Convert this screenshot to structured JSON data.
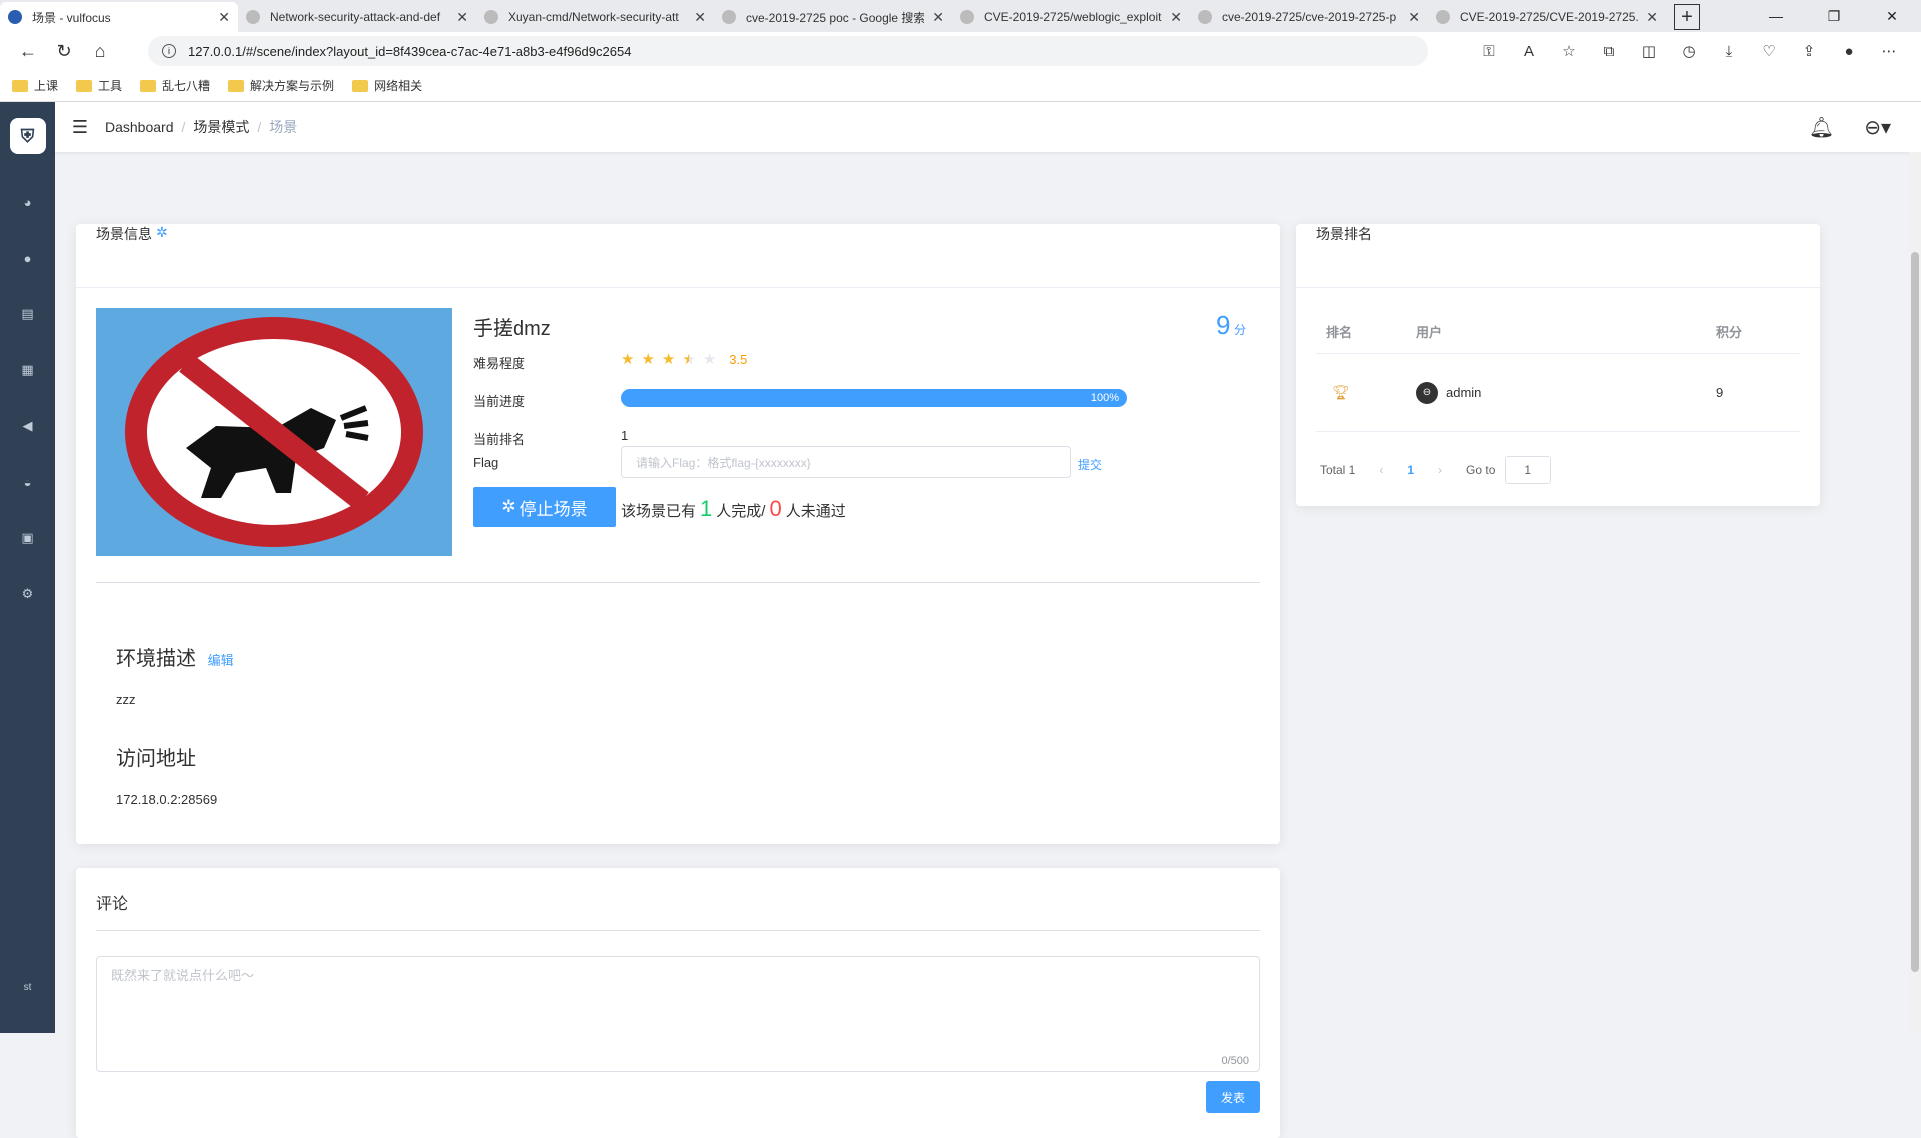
{
  "browser": {
    "tabs": [
      {
        "title": "场景 - vulfocus",
        "active": true
      },
      {
        "title": "Network-security-attack-and-def",
        "active": false
      },
      {
        "title": "Xuyan-cmd/Network-security-att",
        "active": false
      },
      {
        "title": "cve-2019-2725 poc - Google 搜索",
        "active": false
      },
      {
        "title": "CVE-2019-2725/weblogic_exploit",
        "active": false
      },
      {
        "title": "cve-2019-2725/cve-2019-2725-p",
        "active": false
      },
      {
        "title": "CVE-2019-2725/CVE-2019-2725.",
        "active": false
      }
    ],
    "url": "127.0.0.1/#/scene/index?layout_id=8f439cea-c7ac-4e71-a8b3-e4f96d9c2654",
    "bookmarks": [
      "上课",
      "工具",
      "乱七八糟",
      "解决方案与示例",
      "网络相关"
    ]
  },
  "navbar": {
    "breadcrumb": [
      "Dashboard",
      "场景模式",
      "场景"
    ]
  },
  "scene": {
    "header": "场景信息",
    "title": "手搓dmz",
    "score": "9",
    "score_unit": "分",
    "difficulty_label": "难易程度",
    "difficulty_value": "3.5",
    "progress_label": "当前进度",
    "progress_value": 1.0,
    "progress_text": "100%",
    "rank_label": "当前排名",
    "rank_value": "1",
    "flag_label": "Flag",
    "flag_placeholder": "请输入Flag：格式flag-{xxxxxxxx}",
    "submit_label": "提交",
    "stop_button": "停止场景",
    "finish_prefix": "该场景已有",
    "finish_count": "1",
    "finish_mid": "人完成/",
    "fail_count": "0",
    "finish_suffix": "人未通过",
    "env_title": "环境描述",
    "edit_label": "编辑",
    "env_desc": "zzz",
    "addr_title": "访问地址",
    "addr_value": "172.18.0.2:28569"
  },
  "comment": {
    "title": "评论",
    "placeholder": "既然来了就说点什么吧～",
    "counter": "0/500",
    "publish_button": "发表"
  },
  "ranking": {
    "header": "场景排名",
    "columns": [
      "排名",
      "用户",
      "积分"
    ],
    "rows": [
      {
        "user": "admin",
        "score": "9"
      }
    ],
    "total": "Total 1",
    "page": "1",
    "goto_label": "Go to",
    "goto_value": "1"
  },
  "sidebar": {
    "bottom_text": "st"
  },
  "colors": {
    "accent": "#409eff",
    "sidebar": "#304156",
    "success": "#13ce66",
    "danger": "#ff4949",
    "star": "#f7ba2a"
  }
}
